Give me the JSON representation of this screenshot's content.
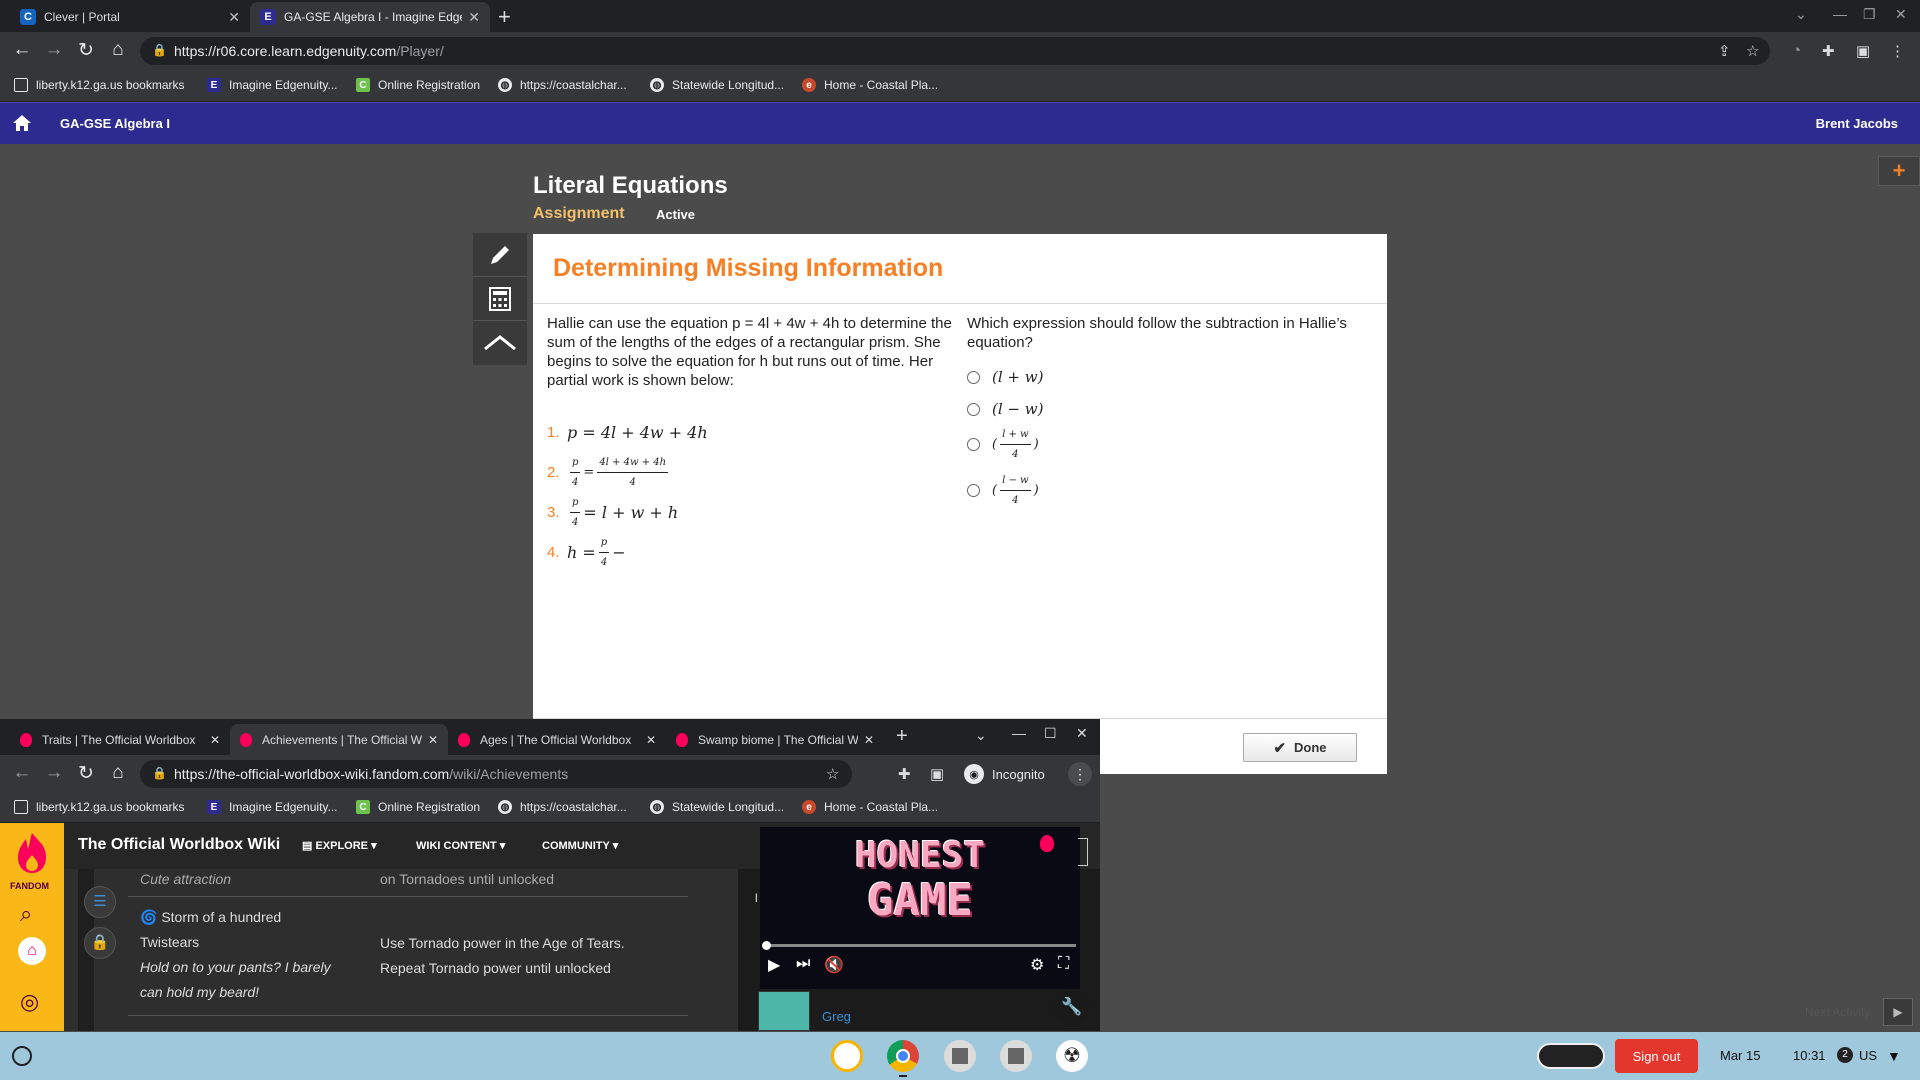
{
  "browser": {
    "tabs": [
      {
        "title": "Clever | Portal",
        "active": false
      },
      {
        "title": "GA-GSE Algebra I - Imagine Edge",
        "active": true
      }
    ],
    "url_host": "https://r06.core.learn.edgenuity.com",
    "url_path": "/Player/",
    "bookmarks": [
      "liberty.k12.ga.us bookmarks",
      "Imagine Edgenuity...",
      "Online Registration",
      "https://coastalchar...",
      "Statewide Longitud...",
      "Home - Coastal Pla..."
    ]
  },
  "edgenuity": {
    "course": "GA-GSE Algebra I",
    "user": "Brent Jacobs",
    "lesson_title": "Literal Equations",
    "lesson_type": "Assignment",
    "lesson_status": "Active",
    "card_title": "Determining Missing Information",
    "question_text": "Hallie can use the equation p = 4l + 4w + 4h to determine the sum of the lengths of the edges of a rectangular prism. She begins to solve the equation for h but runs out of time. Her partial work is shown below:",
    "steps": [
      {
        "num": "1.",
        "expr": "p = 4l + 4w + 4h"
      },
      {
        "num": "2.",
        "lhs_num": "p",
        "lhs_den": "4",
        "rhs_num": "4l + 4w + 4h",
        "rhs_den": "4"
      },
      {
        "num": "3.",
        "lhs_num": "p",
        "lhs_den": "4",
        "rhs": "= l + w + h"
      },
      {
        "num": "4.",
        "lhs": "h =",
        "frac_num": "p",
        "frac_den": "4",
        "tail": "−"
      }
    ],
    "prompt": "Which expression should follow the subtraction in Hallie’s equation?",
    "options": [
      {
        "text": "(l + w)"
      },
      {
        "text": "(l − w)"
      },
      {
        "num": "l + w",
        "den": "4"
      },
      {
        "num": "l − w",
        "den": "4"
      }
    ],
    "done_label": "Done",
    "next_activity": "Next Activity"
  },
  "incognito_window": {
    "tabs": [
      {
        "title": "Traits | The Official Worldbox",
        "active": false
      },
      {
        "title": "Achievements | The Official W",
        "active": true
      },
      {
        "title": "Ages | The Official Worldbox",
        "active": false
      },
      {
        "title": "Swamp biome | The Official W",
        "active": false
      }
    ],
    "url_host": "https://the-official-worldbox-wiki.fandom.com",
    "url_path": "/wiki/Achievements",
    "incognito_label": "Incognito",
    "bookmarks": [
      "liberty.k12.ga.us bookmarks",
      "Imagine Edgenuity...",
      "Online Registration",
      "https://coastalchar...",
      "Statewide Longitud...",
      "Home - Coastal Pla..."
    ],
    "fandom": {
      "brand": "FANDOM",
      "wiki_name": "The Official Worldbox Wiki",
      "nav": [
        "EXPLORE",
        "WIKI CONTENT",
        "COMMUNITY"
      ],
      "row_prev_left": "Cute attraction",
      "row_prev_right": "on Tornadoes until unlocked",
      "achievement_name": "Storm of a hundred Twistears",
      "achievement_quote_1": "Hold on to your pants? I barely",
      "achievement_quote_2": "can hold my beard!",
      "achievement_req_1": "Use Tornado power in the Age of Tears.",
      "achievement_req_2": "Repeat Tornado power until unlocked",
      "sidebar_user": "Greg",
      "video_line_1": "HONEST",
      "video_line_2": "GAME"
    }
  },
  "shelf": {
    "sign_out": "Sign out",
    "date": "Mar 15",
    "time": "10:31",
    "notification_count": "2",
    "locale": "US"
  }
}
